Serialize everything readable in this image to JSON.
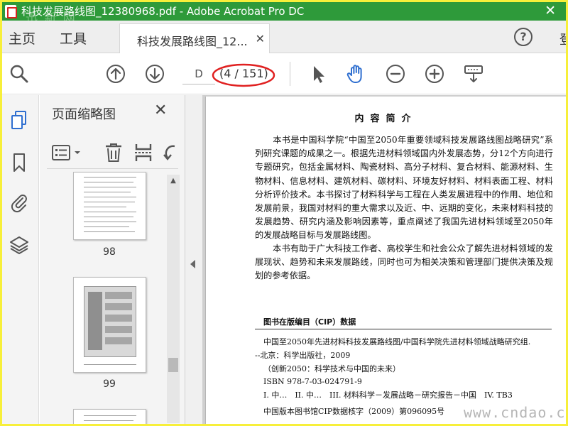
{
  "window": {
    "title": "科技发展路线图_12380968.pdf - Adobe Acrobat Pro DC",
    "watermark_top": "迅 新 网",
    "close_glyph": "✕"
  },
  "tabs": {
    "home": "主页",
    "tools": "工具",
    "document_tab": "科技发展路线图_12...",
    "close_glyph": "✕",
    "help": "?",
    "login": "登"
  },
  "toolbar": {
    "page_input": "D",
    "page_count": "(4 / 151)",
    "icons": [
      "search-zoom-icon",
      "page-up-icon",
      "page-down-icon",
      "select-arrow-icon",
      "hand-tool-icon",
      "zoom-out-icon",
      "zoom-in-icon",
      "keyboard-scroll-icon"
    ]
  },
  "sidebar_rail": {
    "icons": [
      "page-thumbnails-icon",
      "bookmark-icon",
      "attachment-icon",
      "layers-icon"
    ]
  },
  "thumbnails_panel": {
    "title": "页面缩略图",
    "close_glyph": "✕",
    "tools": [
      "options-menu-icon",
      "delete-icon",
      "insert-page-icon",
      "undo-icon"
    ],
    "pages": [
      {
        "label": "98"
      },
      {
        "label": "99"
      }
    ]
  },
  "document": {
    "heading": "内容简介",
    "paragraph1": "本书是中国科学院“中国至2050年重要领域科技发展路线图战略研究”系列研究课题的成果之一。根据先进材料领域国内外发展态势，分12个方向进行专题研究，包括金属材料、陶瓷材料、高分子材料、复合材料、能源材料、生物材料、信息材料、建筑材料、碳材料、环境友好材料、材料表面工程、材料分析评价技术。本书探讨了材料科学与工程在人类发展进程中的作用、地位和发展前景，我国对材料的重大需求以及近、中、远期的变化，未来材料科技的发展趋势、研究内涵及影响因素等，重点阐述了我国先进材料领域至2050年的发展战略目标与发展路线图。",
    "paragraph2": "本书有助于广大科技工作者、高校学生和社会公众了解先进材料领域的发展现状、趋势和未来发展路线，同时也可为相关决策和管理部门提供决策及规划的参考依据。",
    "cip_title": "图书在版编目（CIP）数据",
    "cip_lines": [
      "中国至2050年先进材料科技发展路线图/中国科学院先进材料领域战略研究组.",
      "--北京：科学出版社，2009",
      "（创新2050：科学技术与中国的未来）",
      "ISBN 978-7-03-024791-9",
      "I. 中…　II. 中…　III. 材料科学－发展战略－研究报告－中国　IV. TB3",
      "中国版本图书馆CIP数据核字（2009）第096095号"
    ]
  },
  "watermark_bottom": "www.cndao.com",
  "colors": {
    "titlebar": "#2e9a3a",
    "frame": "#f7ef3a",
    "accent_blue": "#2f6fd0",
    "annotation_red": "#e02020"
  }
}
